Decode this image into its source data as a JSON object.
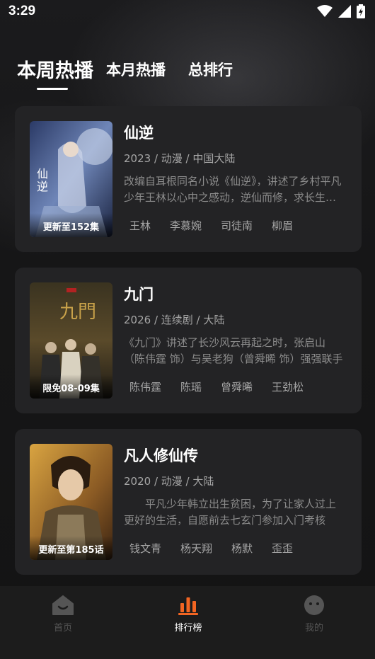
{
  "status_bar": {
    "time": "3:29"
  },
  "tabs": [
    {
      "label": "本周热播"
    },
    {
      "label": "本月热播"
    },
    {
      "label": "总排行"
    }
  ],
  "items": [
    {
      "title": "仙逆",
      "meta": "2023 / 动漫 / 中国大陆",
      "description": "改编自耳根同名小说《仙逆》，讲述了乡村平凡少年王林以心中之感动，逆仙而修，求长生，更追求逆",
      "badge": "更新至152集",
      "cast": [
        "王林",
        "李慕婉",
        "司徒南",
        "柳眉"
      ]
    },
    {
      "title": "九门",
      "meta": "2026 / 连续剧 / 大陆",
      "description": "《九门》讲述了长沙风云再起之时，张启山（陈伟霆 饰）与吴老狗（曾舜晞 饰）强强联手",
      "badge": "限免08-09集",
      "cast": [
        "陈伟霆",
        "陈瑶",
        "曾舜晞",
        "王劲松"
      ]
    },
    {
      "title": "凡人修仙传",
      "meta": "2020 / 动漫 / 大陆",
      "description": "平凡少年韩立出生贫困，为了让家人过上更好的生活，自愿前去七玄门参加入门考核",
      "badge": "更新至第185话",
      "cast": [
        "钱文青",
        "杨天翔",
        "杨默",
        "歪歪"
      ]
    }
  ],
  "bottom_nav": [
    {
      "label": "首页",
      "icon": "home-icon"
    },
    {
      "label": "排行榜",
      "icon": "ranking-icon",
      "active": true
    },
    {
      "label": "我的",
      "icon": "profile-icon"
    }
  ],
  "colors": {
    "accent": "#f26522",
    "background": "#141414",
    "card": "#232325"
  }
}
